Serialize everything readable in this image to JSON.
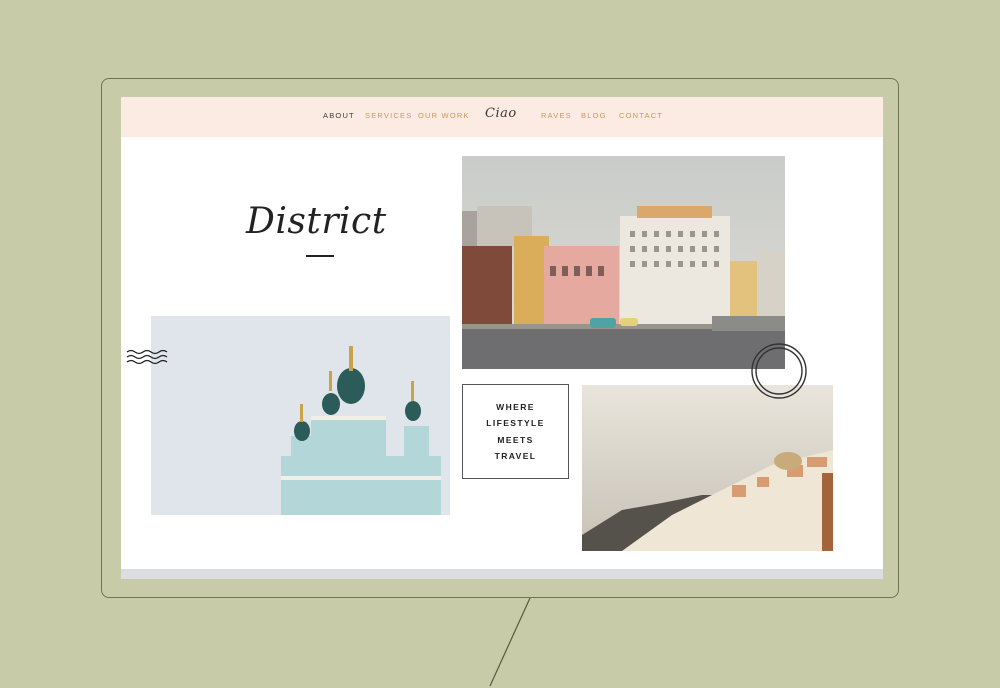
{
  "nav": {
    "left_items": [
      {
        "label": "About",
        "active": true
      },
      {
        "label": "Services",
        "active": false
      },
      {
        "label": "Our Work",
        "active": false
      }
    ],
    "logo": "Ciao",
    "right_items": [
      {
        "label": "Raves"
      },
      {
        "label": "Blog"
      },
      {
        "label": "Contact"
      }
    ]
  },
  "hero": {
    "brand": "District"
  },
  "tagline": {
    "lines": [
      "Where",
      "Lifestyle",
      "Meets",
      "Travel"
    ]
  },
  "colors": {
    "background": "#c8cba8",
    "nav_bg": "#fcebe2",
    "nav_link": "#c9985a",
    "text": "#222222"
  },
  "icons": {
    "waves": "waves-icon",
    "circle": "circle-decoration-icon"
  }
}
